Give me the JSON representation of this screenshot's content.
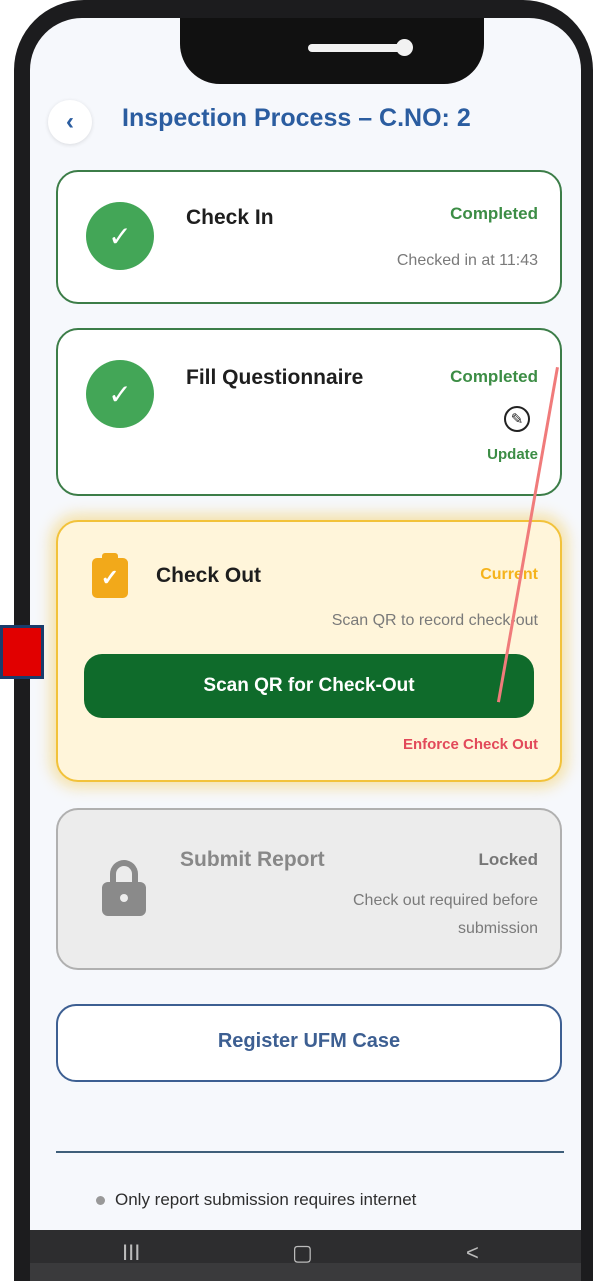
{
  "header": {
    "back_icon": "chevron-left-icon",
    "title": "Inspection Process – C.NO: 2"
  },
  "steps": {
    "check_in": {
      "title": "Check In",
      "status": "Completed",
      "detail": "Checked in at 11:43"
    },
    "questionnaire": {
      "title": "Fill Questionnaire",
      "status": "Completed",
      "update_label": "Update"
    },
    "check_out": {
      "title": "Check Out",
      "status": "Current",
      "detail": "Scan QR to record check-out",
      "button_label": "Scan QR for Check-Out",
      "enforce_label": "Enforce Check Out"
    },
    "submit": {
      "title": "Submit Report",
      "status": "Locked",
      "detail_line1": "Check out required before",
      "detail_line2": "submission"
    }
  },
  "ufm_button": "Register UFM Case",
  "footnote": "Only report submission requires internet",
  "nav": {
    "recent": "III",
    "home": "▢",
    "back": "<"
  },
  "colors": {
    "accent": "#2b5da0",
    "completed": "#43a657",
    "current": "#f2c23a",
    "primary_button": "#0f6b2b",
    "enforce": "#e2495a",
    "locked": "#8a8a8a"
  }
}
